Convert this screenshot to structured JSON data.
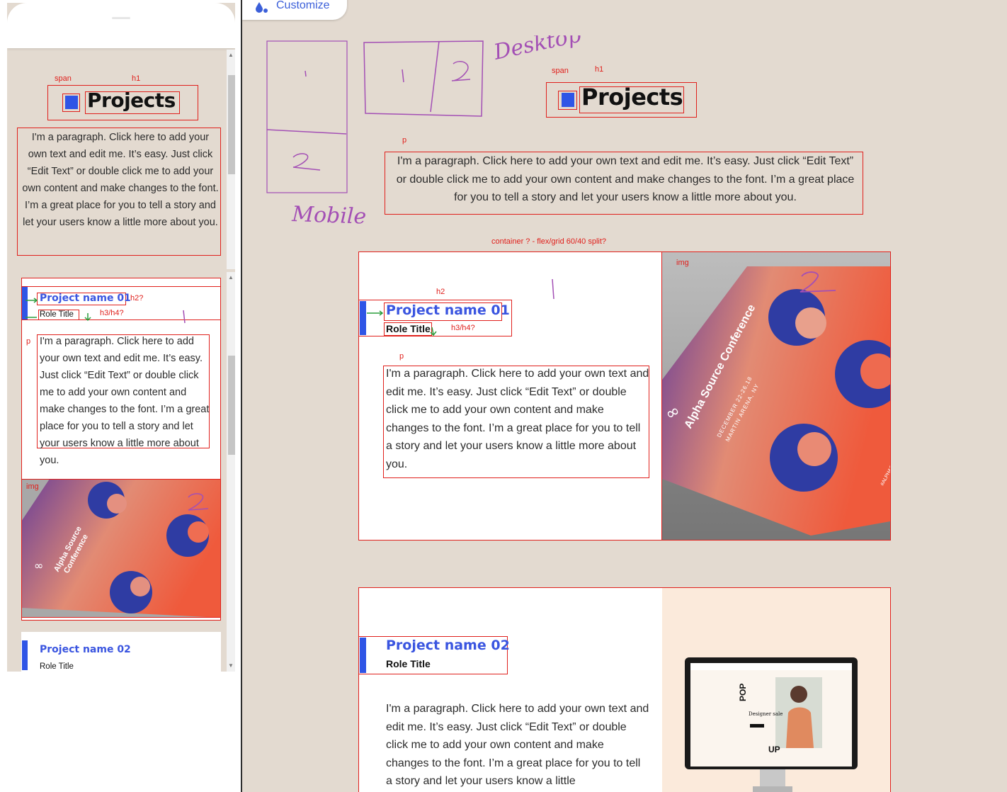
{
  "toolbar": {
    "customize_label": "Customize"
  },
  "annotations": {
    "span": "span",
    "h1": "h1",
    "p": "p",
    "h2": "h2",
    "h2_question": "h2?",
    "h3h4": "h3/h4?",
    "img": "img",
    "container_note": "container ? - flex/grid 60/40 split?"
  },
  "sketch": {
    "mobile_label": "Mobile",
    "desktop_label": "Desktop",
    "num_1": "1",
    "num_2": "2"
  },
  "page": {
    "heading": "Projects",
    "intro": "I'm a paragraph. Click here to add your own text and edit me. It’s easy. Just click “Edit Text” or double click me to add your own content and make changes to the font. I’m a great place for you to tell a story and let your users know a little more about you.",
    "projects": [
      {
        "name": "Project name 01",
        "role": "Role Title",
        "paragraph": "I'm a paragraph. Click here to add your own text and edit me. It’s easy. Just click “Edit Text” or double click me to add your own content and make changes to the font. I’m a great place for you to tell a story and let your users know a little more about you.",
        "poster": {
          "title": "Alpha Source Conference",
          "date": "DECEMBER 22-26.18",
          "venue": "MARTIN ARENA, NY",
          "tag": "#ALPHASOURCE"
        }
      },
      {
        "name": "Project name 02",
        "role": "Role Title",
        "paragraph": "I'm a paragraph. Click here to add your own text and edit me. It’s easy. Just click “Edit Text” or double click me to add your own content and make changes to the font. I’m a great place for you to tell a story and let your users know a little",
        "mockup": {
          "brand": "POP UP",
          "tagline": "Designer sale"
        }
      }
    ]
  },
  "colors": {
    "background": "#e3dad0",
    "accent": "#2f55e6",
    "project_name": "#3a55e0",
    "annotation": "#e0201c",
    "sketch": "#a34fb5",
    "arrow": "#2a9d3b"
  }
}
